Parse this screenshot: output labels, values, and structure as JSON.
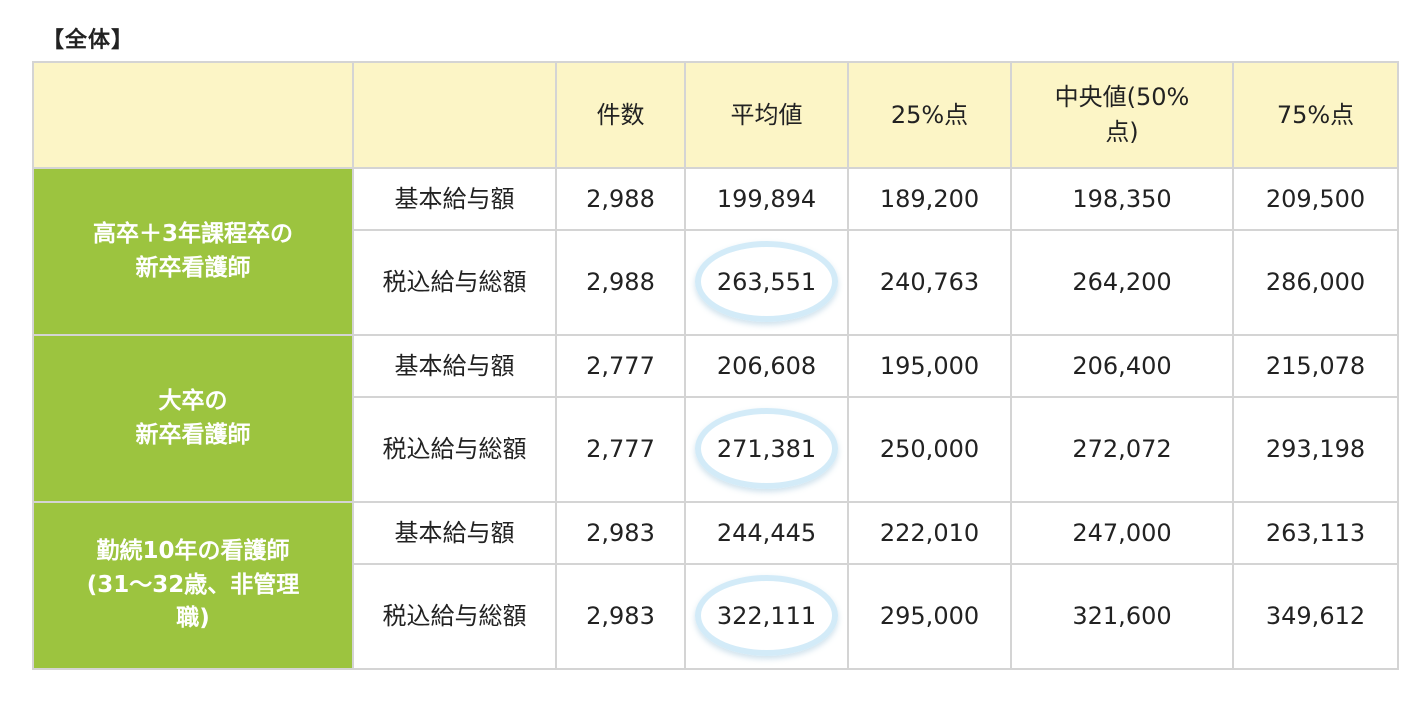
{
  "caption": "【全体】",
  "header": {
    "corner1": "",
    "corner2": "",
    "count": "件数",
    "mean": "平均値",
    "p25": "25%点",
    "median_line1": "中央値(50%",
    "median_line2": "点)",
    "p75": "75%点"
  },
  "groups": [
    {
      "label_lines": [
        "高卒＋3年課程卒の",
        "新卒看護師"
      ],
      "rows": [
        {
          "item": "基本給与額",
          "count": "2,988",
          "mean": "199,894",
          "p25": "189,200",
          "median": "198,350",
          "p75": "209,500"
        },
        {
          "item": "税込給与総額",
          "count": "2,988",
          "mean": "263,551",
          "p25": "240,763",
          "median": "264,200",
          "p75": "286,000"
        }
      ]
    },
    {
      "label_lines": [
        "大卒の",
        "新卒看護師"
      ],
      "rows": [
        {
          "item": "基本給与額",
          "count": "2,777",
          "mean": "206,608",
          "p25": "195,000",
          "median": "206,400",
          "p75": "215,078"
        },
        {
          "item": "税込給与総額",
          "count": "2,777",
          "mean": "271,381",
          "p25": "250,000",
          "median": "272,072",
          "p75": "293,198"
        }
      ]
    },
    {
      "label_lines": [
        "勤続10年の看護師",
        "(31～32歳、非管理",
        "職)"
      ],
      "rows": [
        {
          "item": "基本給与額",
          "count": "2,983",
          "mean": "244,445",
          "p25": "222,010",
          "median": "247,000",
          "p75": "263,113"
        },
        {
          "item": "税込給与総額",
          "count": "2,983",
          "mean": "322,111",
          "p25": "295,000",
          "median": "321,600",
          "p75": "349,612"
        }
      ]
    }
  ],
  "colors": {
    "header_bg": "#fcf5c6",
    "group_bg": "#9cc43f",
    "highlight_ring": "#d3ebf8",
    "border": "#d4d4d4"
  }
}
